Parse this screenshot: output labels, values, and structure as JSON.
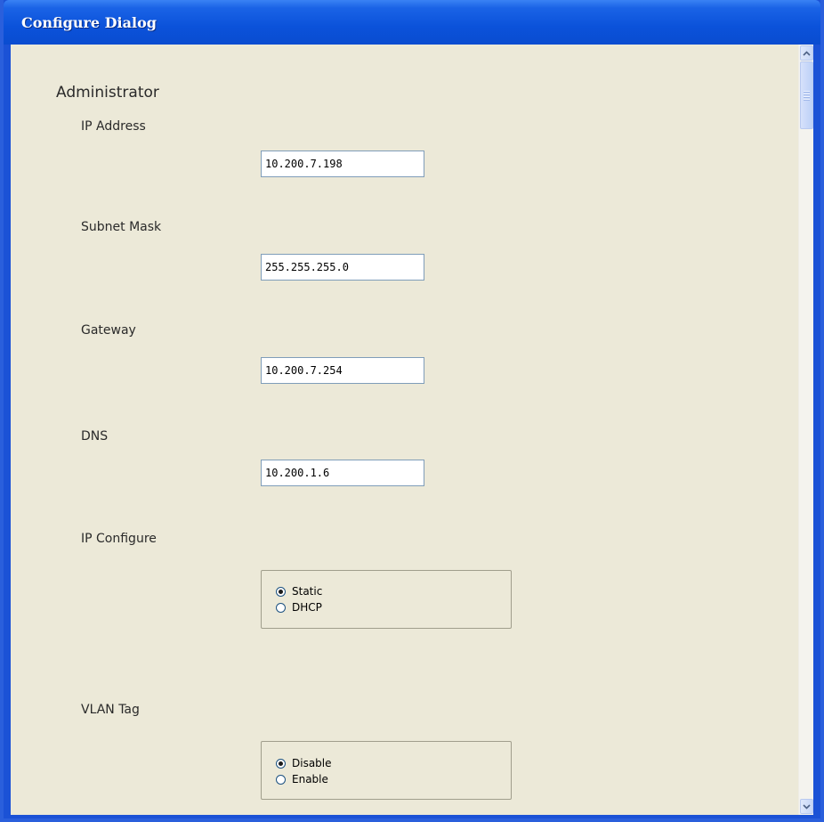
{
  "window": {
    "title": "Configure Dialog"
  },
  "section": {
    "title": "Administrator"
  },
  "fields": {
    "ip_address": {
      "label": "IP Address",
      "value": "10.200.7.198"
    },
    "subnet_mask": {
      "label": "Subnet Mask",
      "value": "255.255.255.0"
    },
    "gateway": {
      "label": "Gateway",
      "value": "10.200.7.254"
    },
    "dns": {
      "label": "DNS",
      "value": "10.200.1.6"
    }
  },
  "ip_configure": {
    "label": "IP Configure",
    "options": [
      "Static",
      "DHCP"
    ],
    "selected": "Static"
  },
  "vlan_tag": {
    "label": "VLAN Tag",
    "options": [
      "Disable",
      "Enable"
    ],
    "selected": "Disable"
  },
  "scrollbar": {
    "up_icon": "chevron-up-icon",
    "down_icon": "chevron-down-icon"
  },
  "colors": {
    "title_bar": "#0b52da",
    "client_background": "#ece9d8",
    "field_border": "#7f9db9"
  }
}
